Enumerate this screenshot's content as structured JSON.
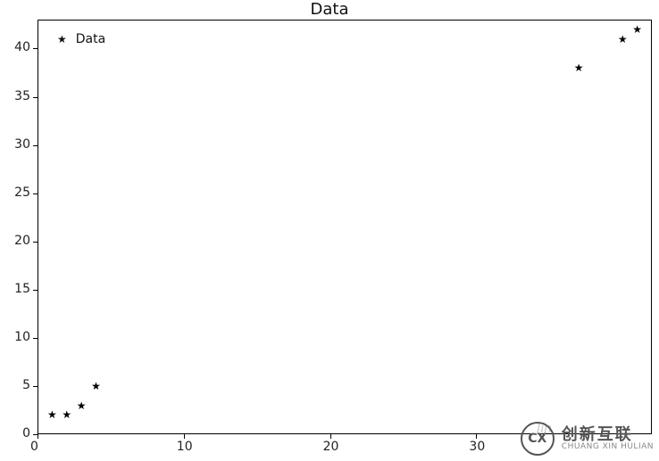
{
  "chart_data": {
    "type": "scatter",
    "title": "Data",
    "xlabel": "",
    "ylabel": "",
    "xlim": [
      0,
      42
    ],
    "ylim": [
      0,
      43
    ],
    "xticks": [
      0,
      10,
      20,
      30
    ],
    "yticks": [
      0,
      5,
      10,
      15,
      20,
      25,
      30,
      35,
      40
    ],
    "series": [
      {
        "name": "Data",
        "marker": "star",
        "x": [
          1,
          2,
          3,
          4,
          37,
          40,
          41
        ],
        "y": [
          2,
          2,
          3,
          5,
          38,
          41,
          42
        ]
      }
    ],
    "legend": {
      "position": "upper-left",
      "entries": [
        "Data"
      ]
    }
  },
  "watermark": {
    "faint_text": "Jin",
    "logo_letters": "CX",
    "brand_cn": "创新互联",
    "brand_en": "CHUANG XIN HULIAN"
  }
}
